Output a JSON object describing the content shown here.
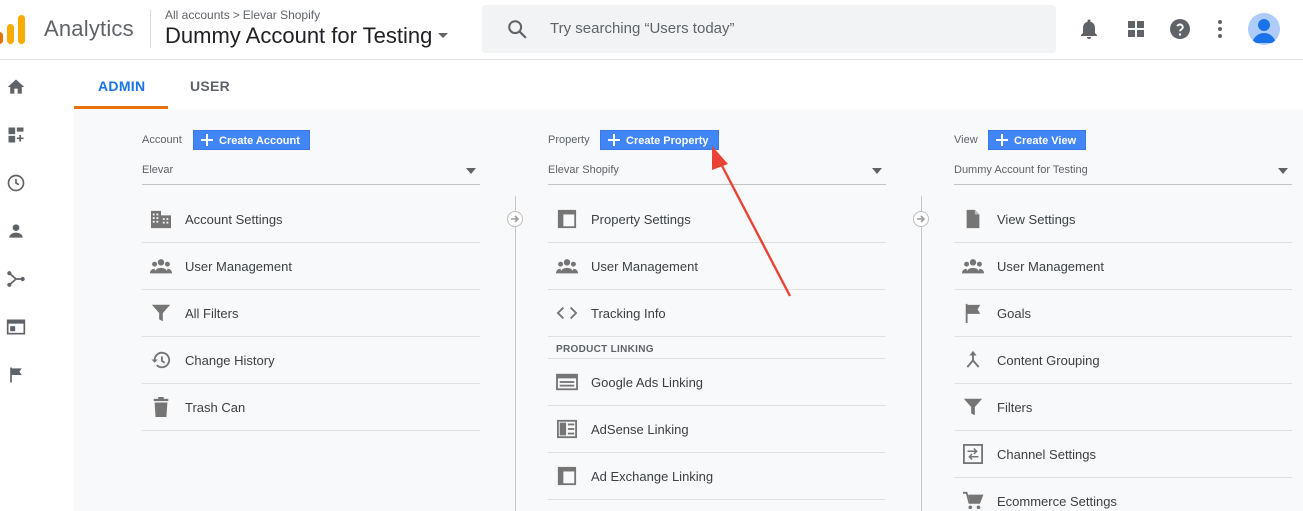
{
  "header": {
    "app_name": "Analytics",
    "breadcrumb": {
      "root": "All accounts",
      "separator": ">",
      "current": "Elevar Shopify"
    },
    "account_title": "Dummy Account for Testing",
    "search_placeholder": "Try searching “Users today”",
    "icons": [
      "bell-icon",
      "apps-icon",
      "help-icon",
      "more-vert-icon",
      "avatar"
    ]
  },
  "leftnav": {
    "icons": [
      "home-icon",
      "customization-icon",
      "realtime-icon",
      "audience-icon",
      "acquisition-icon",
      "behavior-icon",
      "conversions-icon"
    ]
  },
  "tabs": [
    {
      "label": "ADMIN",
      "active": true
    },
    {
      "label": "USER",
      "active": false
    }
  ],
  "columns": {
    "account": {
      "label": "Account",
      "create_label": "Create Account",
      "selected": "Elevar",
      "items": [
        {
          "label": "Account Settings",
          "icon": "building-icon"
        },
        {
          "label": "User Management",
          "icon": "people-icon"
        },
        {
          "label": "All Filters",
          "icon": "filter-icon"
        },
        {
          "label": "Change History",
          "icon": "history-icon"
        },
        {
          "label": "Trash Can",
          "icon": "trash-icon"
        }
      ]
    },
    "property": {
      "label": "Property",
      "create_label": "Create Property",
      "selected": "Elevar Shopify",
      "items": [
        {
          "label": "Property Settings",
          "icon": "property-icon"
        },
        {
          "label": "User Management",
          "icon": "people-icon"
        },
        {
          "label": "Tracking Info",
          "icon": "code-icon"
        }
      ],
      "section_label": "PRODUCT LINKING",
      "linking_items": [
        {
          "label": "Google Ads Linking",
          "icon": "ads-icon"
        },
        {
          "label": "AdSense Linking",
          "icon": "adsense-icon"
        },
        {
          "label": "Ad Exchange Linking",
          "icon": "adexchange-icon"
        }
      ]
    },
    "view": {
      "label": "View",
      "create_label": "Create View",
      "selected": "Dummy Account for Testing",
      "items": [
        {
          "label": "View Settings",
          "icon": "document-icon"
        },
        {
          "label": "User Management",
          "icon": "people-icon"
        },
        {
          "label": "Goals",
          "icon": "flag-icon"
        },
        {
          "label": "Content Grouping",
          "icon": "grouping-icon"
        },
        {
          "label": "Filters",
          "icon": "filter-icon"
        },
        {
          "label": "Channel Settings",
          "icon": "channel-icon"
        },
        {
          "label": "Ecommerce Settings",
          "icon": "cart-icon"
        }
      ]
    }
  },
  "colors": {
    "brand_orange": "#f9ab00",
    "accent_blue": "#1a73e8",
    "button_blue": "#4285f4",
    "annotation_red": "#ea4335",
    "tab_underline": "#e8710a"
  }
}
